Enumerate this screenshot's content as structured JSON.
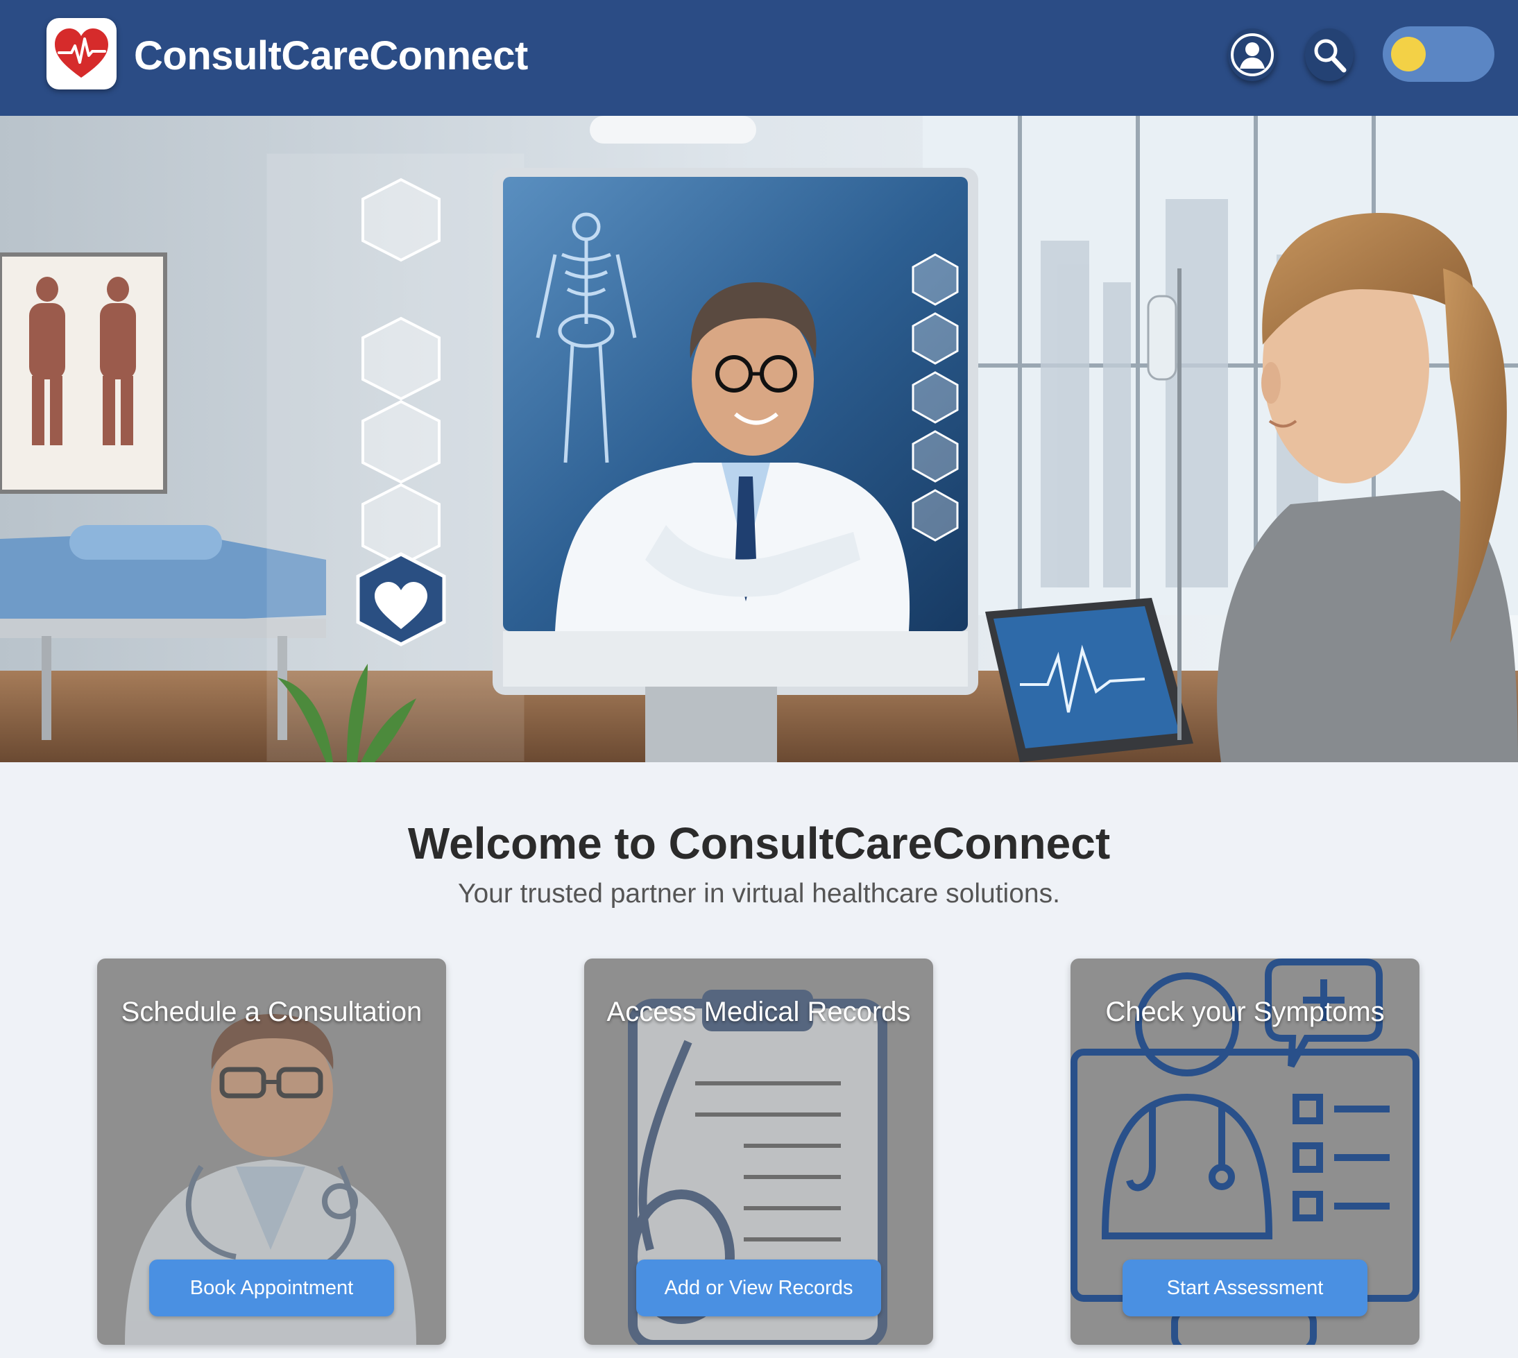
{
  "header": {
    "title": "ConsultCareConnect",
    "icons": {
      "logo": "heart-pulse-icon",
      "user": "user-icon",
      "search": "search-icon",
      "theme_toggle": "sun-toggle"
    },
    "colors": {
      "header_bg": "#2b4c85",
      "toggle_track": "#5b86c4",
      "toggle_knob": "#f3d146"
    }
  },
  "hero": {
    "image": "virtual-consultation-illustration"
  },
  "welcome": {
    "title": "Welcome to ConsultCareConnect",
    "subtitle": "Your trusted partner in virtual healthcare solutions."
  },
  "cards": [
    {
      "title": "Schedule a Consultation",
      "button": "Book Appointment",
      "image": "doctor-illustration"
    },
    {
      "title": "Access Medical Records",
      "button": "Add or View Records",
      "image": "clipboard-stethoscope-illustration"
    },
    {
      "title": "Check your Symptoms",
      "button": "Start Assessment",
      "image": "doctor-checklist-icon"
    }
  ],
  "colors": {
    "page_bg": "#eff2f7",
    "button_bg": "#4a90e2",
    "card_overlay": "#8f8f8f"
  }
}
